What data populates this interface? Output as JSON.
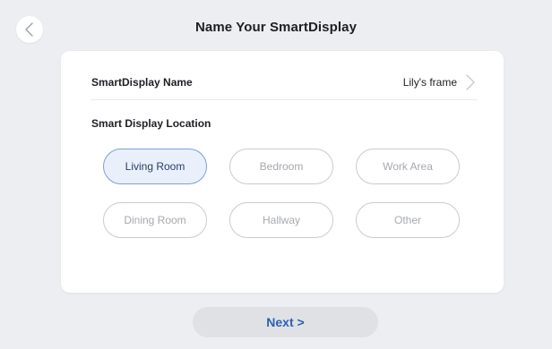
{
  "header": {
    "title": "Name Your SmartDisplay",
    "back_icon": "chevron-left-icon"
  },
  "name_row": {
    "label": "SmartDisplay Name",
    "value": "Lily's frame",
    "icon": "chevron-right-icon"
  },
  "location": {
    "label": "Smart Display Location",
    "selected": "Living Room",
    "options": [
      {
        "label": "Living Room",
        "selected": true
      },
      {
        "label": "Bedroom",
        "selected": false
      },
      {
        "label": "Work Area",
        "selected": false
      },
      {
        "label": "Dining Room",
        "selected": false
      },
      {
        "label": "Hallway",
        "selected": false
      },
      {
        "label": "Other",
        "selected": false
      }
    ]
  },
  "footer": {
    "next_label": "Next >"
  },
  "colors": {
    "background": "#eceef1",
    "accent": "#2f5fb3",
    "selected_fill": "#e9f0fb",
    "selected_border": "#7e9fd6"
  }
}
